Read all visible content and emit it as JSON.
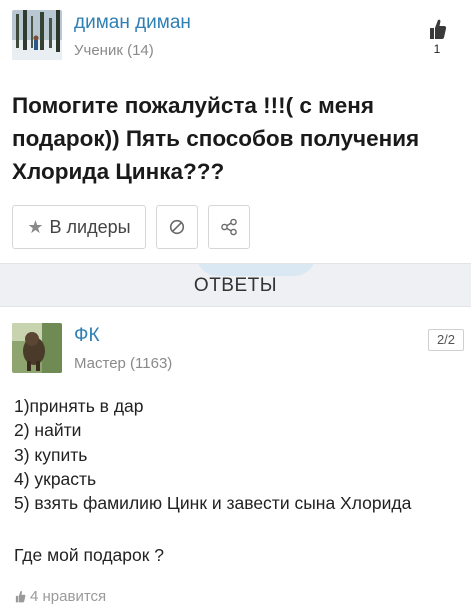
{
  "question": {
    "author": {
      "name": "диман диман",
      "rank": "Ученик (14)",
      "avatar": "winter-forest-photo"
    },
    "likes": "1",
    "title": "Помогите пожалуйста !!!( с меня подарок)) Пять способов получения Хлорида Цинка???",
    "actions": {
      "leaders_label": "В лидеры",
      "leaders_icon": "star-icon",
      "report_icon": "block-icon",
      "share_icon": "share-icon"
    }
  },
  "answers_header": "ОТВЕТЫ",
  "answer": {
    "author": {
      "name": "ФК",
      "rank": "Мастер (1163)",
      "avatar": "animal-photo"
    },
    "pager": "2/2",
    "lines": [
      "1)принять в дар",
      "2) найти",
      "3) купить",
      "4) украсть",
      "5) взять фамилию Цинк и завести сына Хлорида"
    ],
    "closing": "Где мой подарок ?",
    "likes_text": "4 нравится"
  },
  "colors": {
    "link": "#2f7fb3",
    "muted": "#8a8a8a",
    "band": "#eef0f3"
  }
}
